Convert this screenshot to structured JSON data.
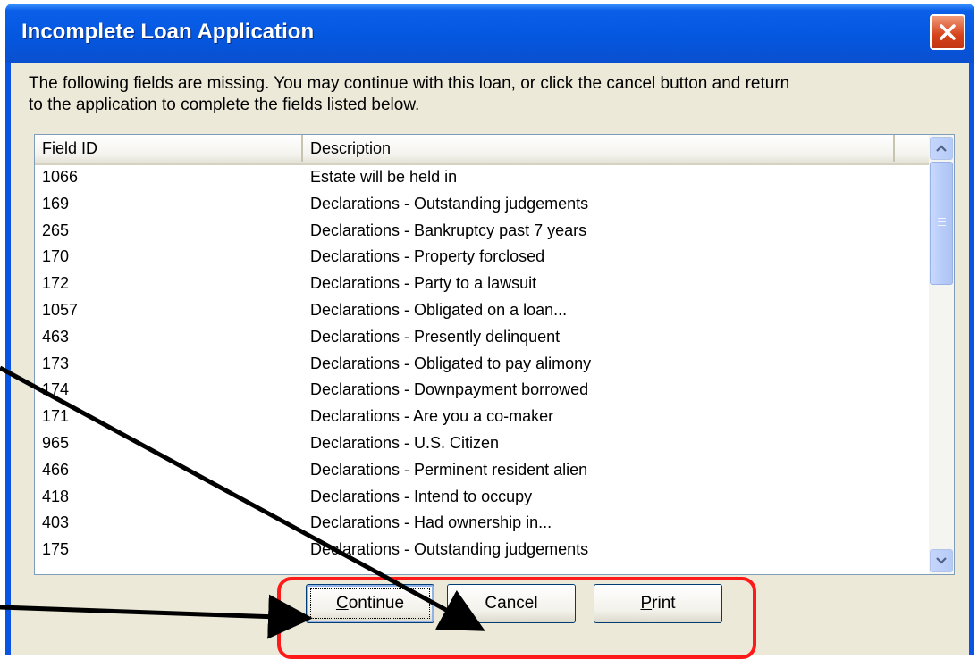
{
  "window": {
    "title": "Incomplete Loan Application",
    "close_icon": "close-x-icon"
  },
  "message": {
    "line1": "The following fields are missing.  You may continue with this loan, or click the cancel button and return",
    "line2": "to the application to complete the fields listed below."
  },
  "list": {
    "columns": [
      "Field ID",
      "Description"
    ],
    "rows": [
      {
        "id": "1066",
        "desc": "Estate will be held in"
      },
      {
        "id": "169",
        "desc": "Declarations - Outstanding judgements"
      },
      {
        "id": "265",
        "desc": "Declarations - Bankruptcy past 7 years"
      },
      {
        "id": "170",
        "desc": "Declarations - Property forclosed"
      },
      {
        "id": "172",
        "desc": "Declarations - Party to a lawsuit"
      },
      {
        "id": "1057",
        "desc": "Declarations - Obligated on a loan..."
      },
      {
        "id": "463",
        "desc": "Declarations - Presently delinquent"
      },
      {
        "id": "173",
        "desc": "Declarations - Obligated to pay alimony"
      },
      {
        "id": "174",
        "desc": "Declarations - Downpayment borrowed"
      },
      {
        "id": "171",
        "desc": "Declarations - Are you a co-maker"
      },
      {
        "id": "965",
        "desc": "Declarations - U.S. Citizen"
      },
      {
        "id": "466",
        "desc": "Declarations - Perminent resident alien"
      },
      {
        "id": "418",
        "desc": "Declarations - Intend to occupy"
      },
      {
        "id": "403",
        "desc": "Declarations - Had ownership in..."
      },
      {
        "id": "175",
        "desc": "Declarations - Outstanding judgements"
      }
    ]
  },
  "buttons": {
    "continue_mnemonic": "C",
    "continue_rest": "ontinue",
    "cancel": "Cancel",
    "print_mnemonic": "P",
    "print_rest": "rint"
  },
  "colors": {
    "titlebar": "#0458e0",
    "client": "#ece9d8",
    "highlight": "#ff1a1a",
    "annotation_arrow": "#000000"
  }
}
